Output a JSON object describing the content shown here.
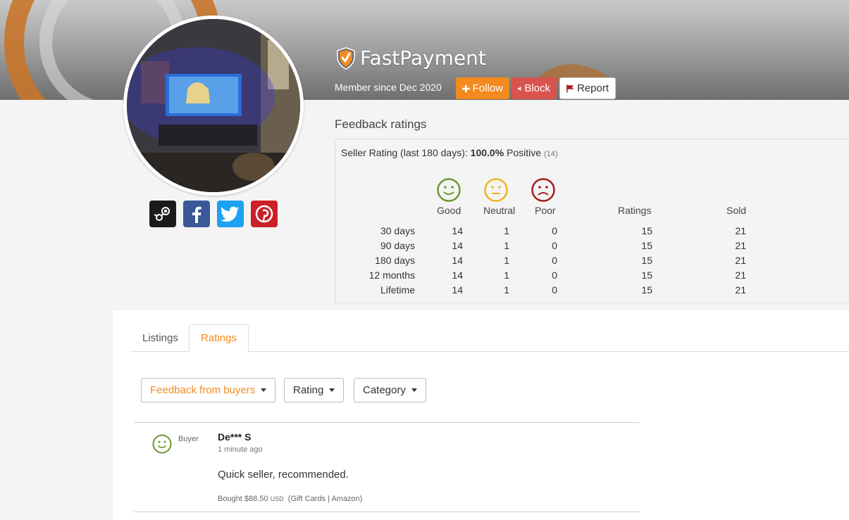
{
  "profile": {
    "username": "FastPayment",
    "member_since": "Member since Dec 2020",
    "avatar_alt": "avatar"
  },
  "actions": {
    "follow": "Follow",
    "block": "Block",
    "report": "Report"
  },
  "social": [
    "steam-icon",
    "facebook-icon",
    "twitter-icon",
    "pinterest-icon"
  ],
  "feedback": {
    "title": "Feedback ratings",
    "seller_rating_label": "Seller Rating (last 180 days):",
    "seller_rating_value": "100.0%",
    "seller_rating_positive": "Positive",
    "seller_rating_count": "(14)",
    "headers": [
      "Good",
      "Neutral",
      "Poor",
      "Ratings",
      "Sold"
    ],
    "rows": [
      {
        "period": "30 days",
        "good": "14",
        "neutral": "1",
        "poor": "0",
        "ratings": "15",
        "sold": "21"
      },
      {
        "period": "90 days",
        "good": "14",
        "neutral": "1",
        "poor": "0",
        "ratings": "15",
        "sold": "21"
      },
      {
        "period": "180 days",
        "good": "14",
        "neutral": "1",
        "poor": "0",
        "ratings": "15",
        "sold": "21"
      },
      {
        "period": "12 months",
        "good": "14",
        "neutral": "1",
        "poor": "0",
        "ratings": "15",
        "sold": "21"
      },
      {
        "period": "Lifetime",
        "good": "14",
        "neutral": "1",
        "poor": "0",
        "ratings": "15",
        "sold": "21"
      }
    ],
    "colors": {
      "good": "#6a9a2f",
      "neutral": "#f0b51c",
      "poor": "#a51c1c"
    }
  },
  "tabs": {
    "listings": "Listings",
    "ratings": "Ratings"
  },
  "filters": {
    "feedback": "Feedback from buyers",
    "rating": "Rating",
    "category": "Category"
  },
  "review": {
    "role": "Buyer",
    "name": "De*** S",
    "time": "1 minute ago",
    "text": "Quick seller, recommended.",
    "bought_prefix": "Bought $88.50",
    "currency": "USD",
    "category": "(Gift Cards | Amazon)"
  },
  "accent": "#f28a1e"
}
